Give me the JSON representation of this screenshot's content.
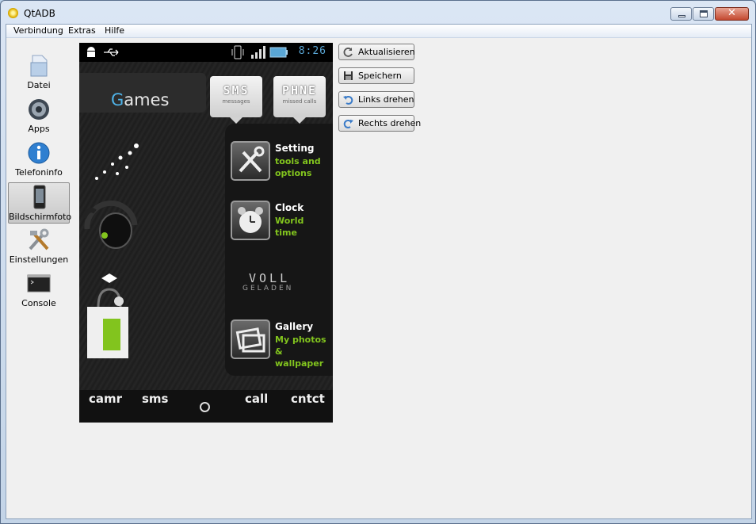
{
  "window": {
    "title": "QtADB"
  },
  "menu": [
    "Verbindung",
    "Extras",
    "Hilfe"
  ],
  "sidebar": {
    "items": [
      {
        "label": "Datei",
        "icon": "file-icon",
        "active": false
      },
      {
        "label": "Apps",
        "icon": "apps-gear-icon",
        "active": false
      },
      {
        "label": "Telefoninfo",
        "icon": "info-icon",
        "active": false
      },
      {
        "label": "Bildschirmfoto",
        "icon": "phone-screenshot-icon",
        "active": true
      },
      {
        "label": "Einstellungen",
        "icon": "tools-icon",
        "active": false
      },
      {
        "label": "Console",
        "icon": "console-icon",
        "active": false
      }
    ]
  },
  "actions": [
    {
      "label": "Aktualisieren",
      "icon": "refresh-icon"
    },
    {
      "label": "Speichern",
      "icon": "save-icon"
    },
    {
      "label": "Links drehen",
      "icon": "rotate-left-icon"
    },
    {
      "label": "Rechts drehen",
      "icon": "rotate-right-icon"
    }
  ],
  "phone": {
    "clock": "8:26",
    "games": {
      "first": "G",
      "rest": "ames"
    },
    "tiles": [
      {
        "big": "SMS",
        "small": "messages"
      },
      {
        "big": "PHNE",
        "small": "missed calls"
      }
    ],
    "apps": [
      {
        "title": "Setting",
        "sub1": "tools and",
        "sub2": "options"
      },
      {
        "title": "Clock",
        "sub1": "World",
        "sub2": "time"
      },
      {
        "title": "Gallery",
        "sub1": "My photos",
        "sub2": "& wallpaper"
      }
    ],
    "voll": "VOLL",
    "geladen": "GELADEN",
    "dock": [
      "camr",
      "sms",
      "call",
      "cntct"
    ]
  },
  "colors": {
    "clock": "#5aa7d6",
    "accent_green": "#82c41e",
    "games_accent": "#4fb3e8"
  }
}
